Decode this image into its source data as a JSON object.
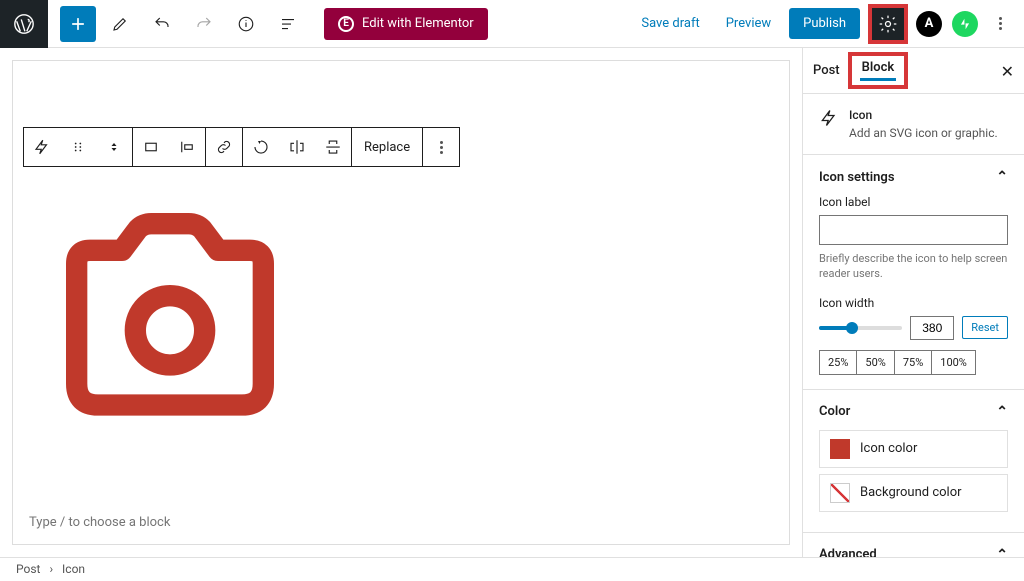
{
  "topbar": {
    "elementor_label": "Edit with Elementor",
    "save_draft": "Save draft",
    "preview": "Preview",
    "publish": "Publish"
  },
  "block_toolbar": {
    "replace": "Replace"
  },
  "editor": {
    "placeholder": "Type / to choose a block"
  },
  "sidebar": {
    "tabs": {
      "post": "Post",
      "block": "Block"
    },
    "block": {
      "name": "Icon",
      "description": "Add an SVG icon or graphic."
    },
    "icon_settings": {
      "heading": "Icon settings",
      "label_field": "Icon label",
      "label_help": "Briefly describe the icon to help screen reader users.",
      "width_label": "Icon width",
      "width_value": "380",
      "reset": "Reset",
      "presets": [
        "25%",
        "50%",
        "75%",
        "100%"
      ]
    },
    "color": {
      "heading": "Color",
      "icon_color": "Icon color",
      "bg_color": "Background color",
      "icon_color_value": "#c0392b"
    },
    "advanced": {
      "heading": "Advanced"
    }
  },
  "breadcrumb": {
    "post": "Post",
    "icon": "Icon"
  }
}
